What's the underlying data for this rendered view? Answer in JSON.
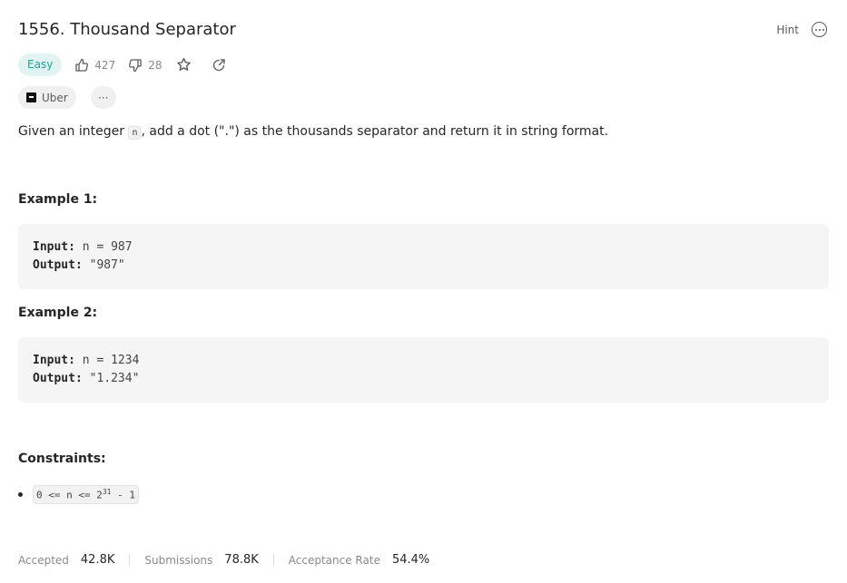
{
  "problem": {
    "title": "1556. Thousand Separator",
    "difficulty": "Easy",
    "likes": "427",
    "dislikes": "28"
  },
  "top_actions": {
    "hint_label": "Hint"
  },
  "tags": {
    "company": "Uber",
    "more_label": "···"
  },
  "description": {
    "before": "Given an integer ",
    "code": "n",
    "after": ", add a dot (\".\") as the thousands separator and return it in string format."
  },
  "examples": [
    {
      "heading": "Example 1:",
      "input_label": "Input:",
      "input": "n = 987",
      "output_label": "Output:",
      "output": "\"987\""
    },
    {
      "heading": "Example 2:",
      "input_label": "Input:",
      "input": "n = 1234",
      "output_label": "Output:",
      "output": "\"1.234\""
    }
  ],
  "constraints": {
    "heading": "Constraints:",
    "item_base": "0 <= n <= 2",
    "item_sup": "31",
    "item_tail": " - 1"
  },
  "stats": {
    "accepted_label": "Accepted",
    "accepted_value": "42.8K",
    "submissions_label": "Submissions",
    "submissions_value": "78.8K",
    "rate_label": "Acceptance Rate",
    "rate_value": "54.4%"
  },
  "colors": {
    "easy_badge_bg": "#e2f4f2",
    "easy_badge_text": "#1fa3a0"
  },
  "icons": [
    "thumbs-up-icon",
    "thumbs-down-icon",
    "star-icon",
    "share-icon",
    "more-options-icon",
    "uber-logo-icon"
  ]
}
